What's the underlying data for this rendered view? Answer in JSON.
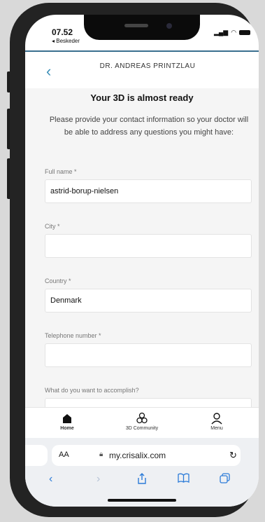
{
  "status_bar": {
    "time": "07.52",
    "back_app": "◂ Beskeder"
  },
  "header": {
    "doctor_name": "DR. ANDREAS PRINTZLAU"
  },
  "main": {
    "title": "Your 3D is almost ready",
    "description": "Please provide your contact information so your doctor will be able to address any questions you might have:"
  },
  "form": {
    "full_name": {
      "label": "Full name *",
      "value": "astrid-borup-nielsen"
    },
    "city": {
      "label": "City *",
      "value": ""
    },
    "country": {
      "label": "Country *",
      "value": "Denmark"
    },
    "telephone": {
      "label": "Telephone number *",
      "value": ""
    },
    "accomplish": {
      "label": "What do you want to accomplish?",
      "value": ""
    }
  },
  "bottom_nav": {
    "home": "Home",
    "community": "3D Community",
    "menu": "Menu"
  },
  "browser": {
    "aa_label": "AA",
    "url": "my.crisalix.com"
  },
  "icons": {
    "back": "chevron-left-icon",
    "home": "home-icon",
    "community": "community-icon",
    "menu": "user-icon",
    "lock": "lock-icon",
    "reload": "reload-icon",
    "share": "share-icon",
    "bookmarks": "book-icon",
    "tabs": "tabs-icon"
  },
  "colors": {
    "accent": "#3b8fb8",
    "safari_blue": "#2b7bd8",
    "header_line": "#3a6f8f"
  }
}
